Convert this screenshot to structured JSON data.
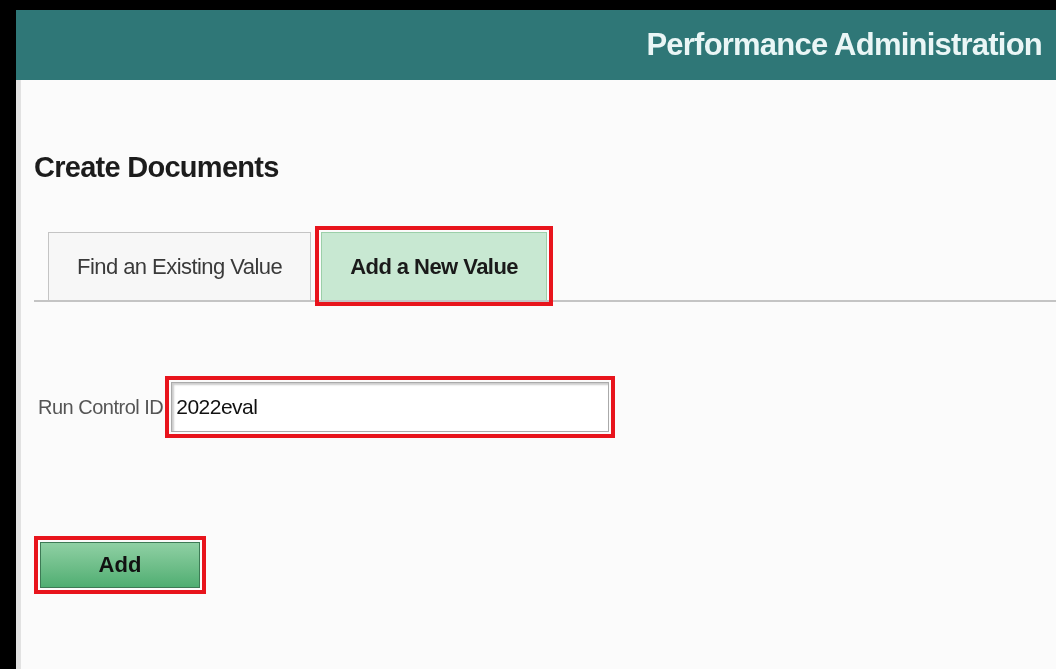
{
  "header": {
    "title": "Performance Administration"
  },
  "page_title": "Create Documents",
  "tabs": [
    {
      "label": "Find an Existing Value",
      "selected": false,
      "highlighted": false
    },
    {
      "label": "Add a New Value",
      "selected": true,
      "highlighted": true
    }
  ],
  "run_control": {
    "label": "Run Control ID",
    "value": "2022eval",
    "highlighted": true
  },
  "add_button": {
    "label": "Add",
    "highlighted": true
  }
}
